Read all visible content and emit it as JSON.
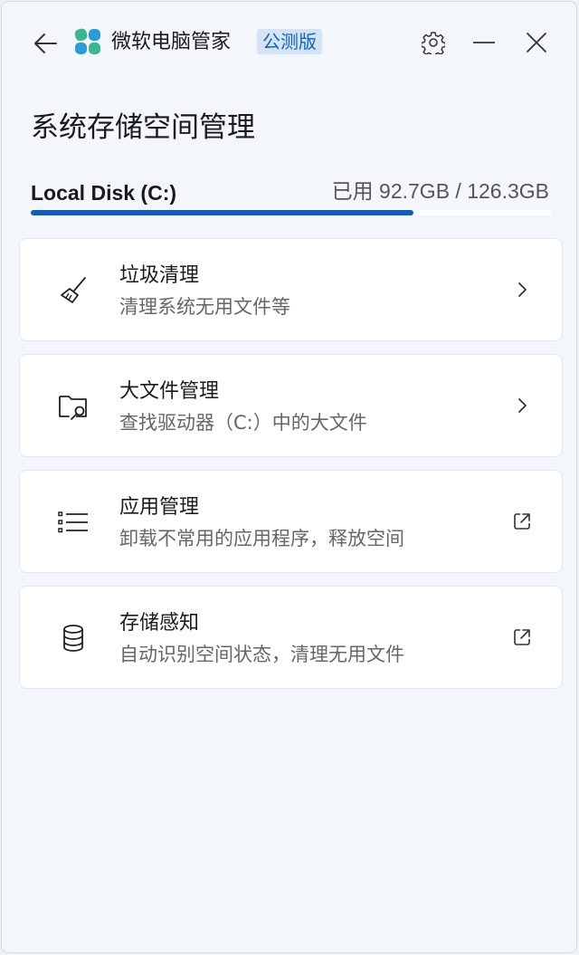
{
  "titlebar": {
    "app_name": "微软电脑管家",
    "badge": "公测版",
    "back_icon": "back-arrow-icon",
    "settings_icon": "gear-icon",
    "minimize_icon": "minimize-icon",
    "close_icon": "close-icon"
  },
  "page": {
    "title": "系统存储空间管理"
  },
  "disk": {
    "name": "Local Disk (C:)",
    "usage_text": "已用 92.7GB / 126.3GB",
    "used_gb": 92.7,
    "total_gb": 126.3,
    "bar_color": "#0f5fb8"
  },
  "items": [
    {
      "title": "垃圾清理",
      "subtitle": "清理系统无用文件等",
      "icon": "broom-icon",
      "action": "chevron-right-icon"
    },
    {
      "title": "大文件管理",
      "subtitle": "查找驱动器（C:）中的大文件",
      "icon": "folder-search-icon",
      "action": "chevron-right-icon"
    },
    {
      "title": "应用管理",
      "subtitle": "卸载不常用的应用程序，释放空间",
      "icon": "list-icon",
      "action": "external-link-icon"
    },
    {
      "title": "存储感知",
      "subtitle": "自动识别空间状态，清理无用文件",
      "icon": "database-icon",
      "action": "external-link-icon"
    }
  ]
}
